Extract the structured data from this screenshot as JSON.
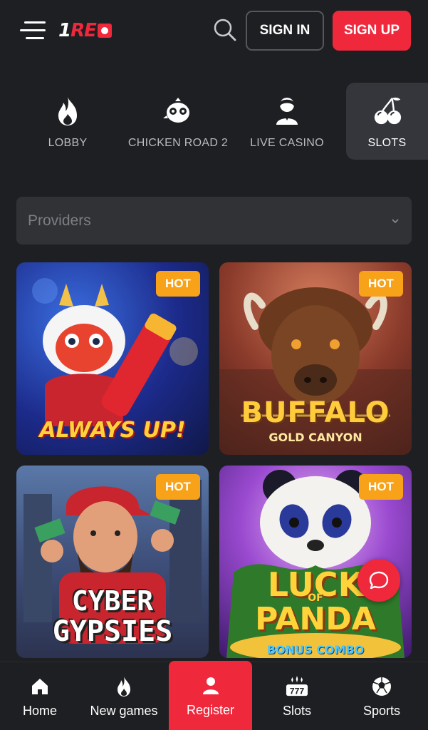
{
  "header": {
    "logo_text_white": "1",
    "logo_text_red": "RE",
    "signin_label": "SIGN IN",
    "signup_label": "SIGN UP"
  },
  "categories": [
    {
      "label": "LOBBY",
      "icon": "fire-icon",
      "active": false
    },
    {
      "label": "CHICKEN ROAD 2",
      "icon": "chicken-icon",
      "active": false
    },
    {
      "label": "LIVE CASINO",
      "icon": "dealer-icon",
      "active": false
    },
    {
      "label": "SLOTS",
      "icon": "cherries-icon",
      "active": true
    }
  ],
  "providers": {
    "placeholder": "Providers"
  },
  "games": [
    {
      "title_line1": "ALWAYS UP!",
      "badge": "HOT"
    },
    {
      "title_line1": "BUFFALO",
      "title_line2": "GOLD CANYON",
      "badge": "HOT"
    },
    {
      "title_line1": "CYBER",
      "title_line2": "GYPSIES",
      "badge": "HOT"
    },
    {
      "title_line1": "LUCK",
      "title_line1b": "OF",
      "title_line2": "PANDA",
      "title_line3": "BONUS COMBO",
      "badge": "HOT"
    }
  ],
  "bottom_nav": [
    {
      "label": "Home",
      "icon": "home-icon"
    },
    {
      "label": "New games",
      "icon": "fire-icon"
    },
    {
      "label": "Register",
      "icon": "user-icon"
    },
    {
      "label": "Slots",
      "icon": "slot-777-icon"
    },
    {
      "label": "Sports",
      "icon": "soccer-ball-icon"
    }
  ],
  "colors": {
    "background": "#1e1f22",
    "accent_red": "#f0283c",
    "hot_badge": "#f7a218",
    "panel": "#303236"
  }
}
